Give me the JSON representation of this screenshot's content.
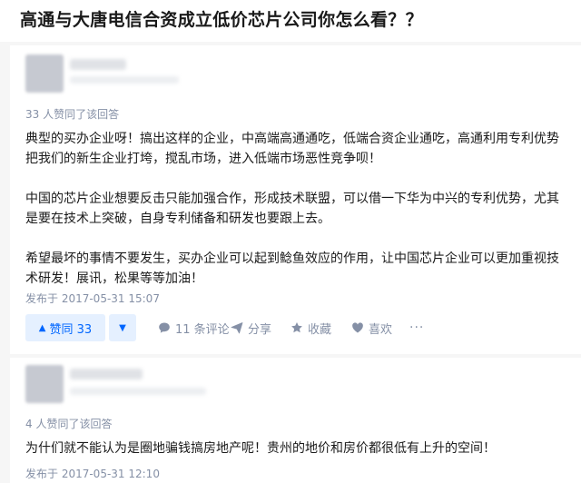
{
  "question": {
    "title": "高通与大唐电信合资成立低价芯片公司你怎么看？？"
  },
  "answers": [
    {
      "votes_text": "33 人赞同了该回答",
      "paragraphs": [
        "典型的买办企业呀！搞出这样的企业，中高端高通通吃，低端合资企业通吃，高通利用专利优势把我们的新生企业打垮，搅乱市场，进入低端市场恶性竞争呗！",
        "中国的芯片企业想要反击只能加强合作，形成技术联盟，可以借一下华为中兴的专利优势，尤其是要在技术上突破，自身专利储备和研发也要跟上去。",
        "希望最坏的事情不要发生，买办企业可以起到鲶鱼效应的作用，让中国芯片企业可以更加重视技术研发！展讯，松果等等加油！"
      ],
      "date": "发布于 2017-05-31 15:07",
      "actions": {
        "upvote": "赞同 33",
        "comments": "11 条评论",
        "share": "分享",
        "collect": "收藏",
        "like": "喜欢",
        "more": "···"
      }
    },
    {
      "votes_text": "4 人赞同了该回答",
      "paragraphs": [
        "为什们就不能认为是圈地骗钱搞房地产呢！贵州的地价和房价都很低有上升的空间！"
      ],
      "date": "发布于 2017-05-31 12:10"
    }
  ],
  "icons": {
    "upvote": "triangle-up-icon",
    "downvote": "triangle-down-icon",
    "comment": "speech-bubble-icon",
    "share": "paper-plane-icon",
    "collect": "star-icon",
    "like": "heart-icon",
    "more": "ellipsis-icon"
  },
  "colors": {
    "accent": "#0066ff",
    "accent_bg": "#e5f0ff",
    "meta": "#8590a6",
    "text": "#1a1a1a",
    "page_bg": "#f6f6f6"
  }
}
